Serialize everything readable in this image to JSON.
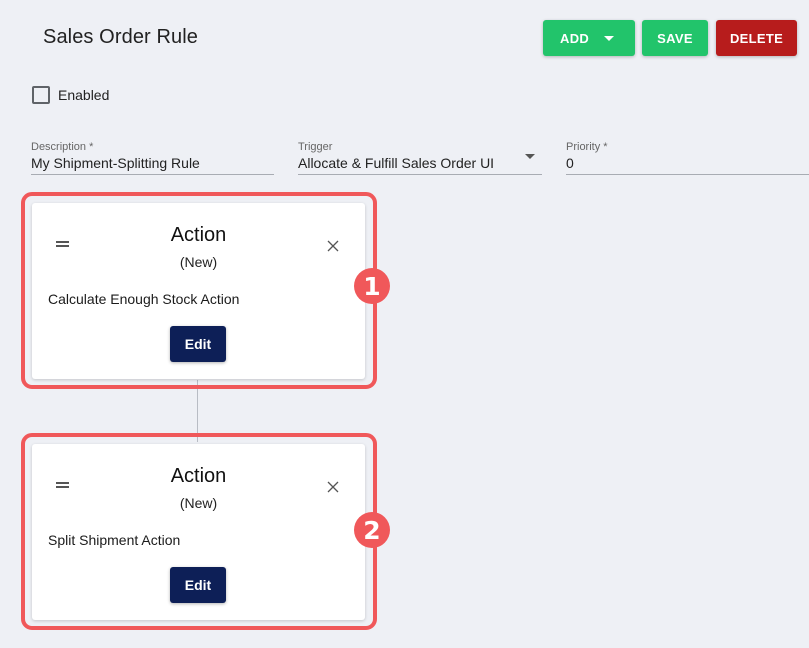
{
  "header": {
    "title": "Sales Order Rule",
    "add_label": "ADD",
    "save_label": "SAVE",
    "delete_label": "DELETE"
  },
  "enabled": {
    "label": "Enabled",
    "checked": false
  },
  "fields": {
    "description": {
      "label": "Description *",
      "value": "My Shipment-Splitting Rule"
    },
    "trigger": {
      "label": "Trigger",
      "value": "Allocate & Fulfill Sales Order UI"
    },
    "priority": {
      "label": "Priority *",
      "value": "0"
    }
  },
  "actions": [
    {
      "title": "Action",
      "status": "(New)",
      "description": "Calculate Enough Stock Action",
      "edit_label": "Edit",
      "step_number": "1"
    },
    {
      "title": "Action",
      "status": "(New)",
      "description": "Split Shipment Action",
      "edit_label": "Edit",
      "step_number": "2"
    }
  ],
  "colors": {
    "primary_green": "#22c46b",
    "delete_red": "#b71c1c",
    "edit_navy": "#0d1f57",
    "highlight_red": "#f0585a",
    "background": "#eef0f5"
  },
  "icons": {
    "add_dropdown": "chevron-down-icon",
    "drag": "drag-handle-icon",
    "close": "close-icon"
  }
}
